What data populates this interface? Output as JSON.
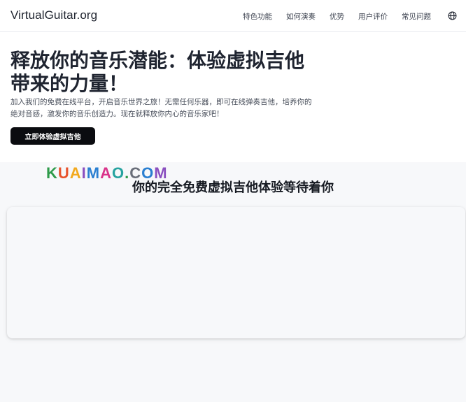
{
  "header": {
    "brand": "VirtualGuitar.org",
    "nav": [
      {
        "label": "特色功能"
      },
      {
        "label": "如何演奏"
      },
      {
        "label": "优势"
      },
      {
        "label": "用户评价"
      },
      {
        "label": "常见问题"
      }
    ],
    "language_icon": "globe-icon"
  },
  "hero": {
    "title": "释放你的音乐潜能：体验虚拟吉他带来的力量！",
    "description": "加入我们的免费在线平台，开启音乐世界之旅！无需任何乐器，即可在线弹奏吉他，培养你的绝对音感，激发你的音乐创造力。现在就释放你内心的音乐家吧！",
    "cta_label": "立即体验虚拟吉他"
  },
  "watermark": {
    "text": "KUAIMAO.COM",
    "colors": [
      "#2e9b4a",
      "#e8542e",
      "#f2a91d",
      "#8a4fbf",
      "#2a7fd1",
      "#d9338a",
      "#27a3a0",
      "#2e9b4a",
      "#6a6f7a",
      "#2a7fd1",
      "#8a4fbf"
    ]
  },
  "section": {
    "title": "你的完全免费虚拟吉他体验等待着你"
  },
  "colors": {
    "background": "#f7f8fa",
    "header": "#ffffff",
    "cta": "#0b0c10",
    "text": "#1f2430"
  }
}
